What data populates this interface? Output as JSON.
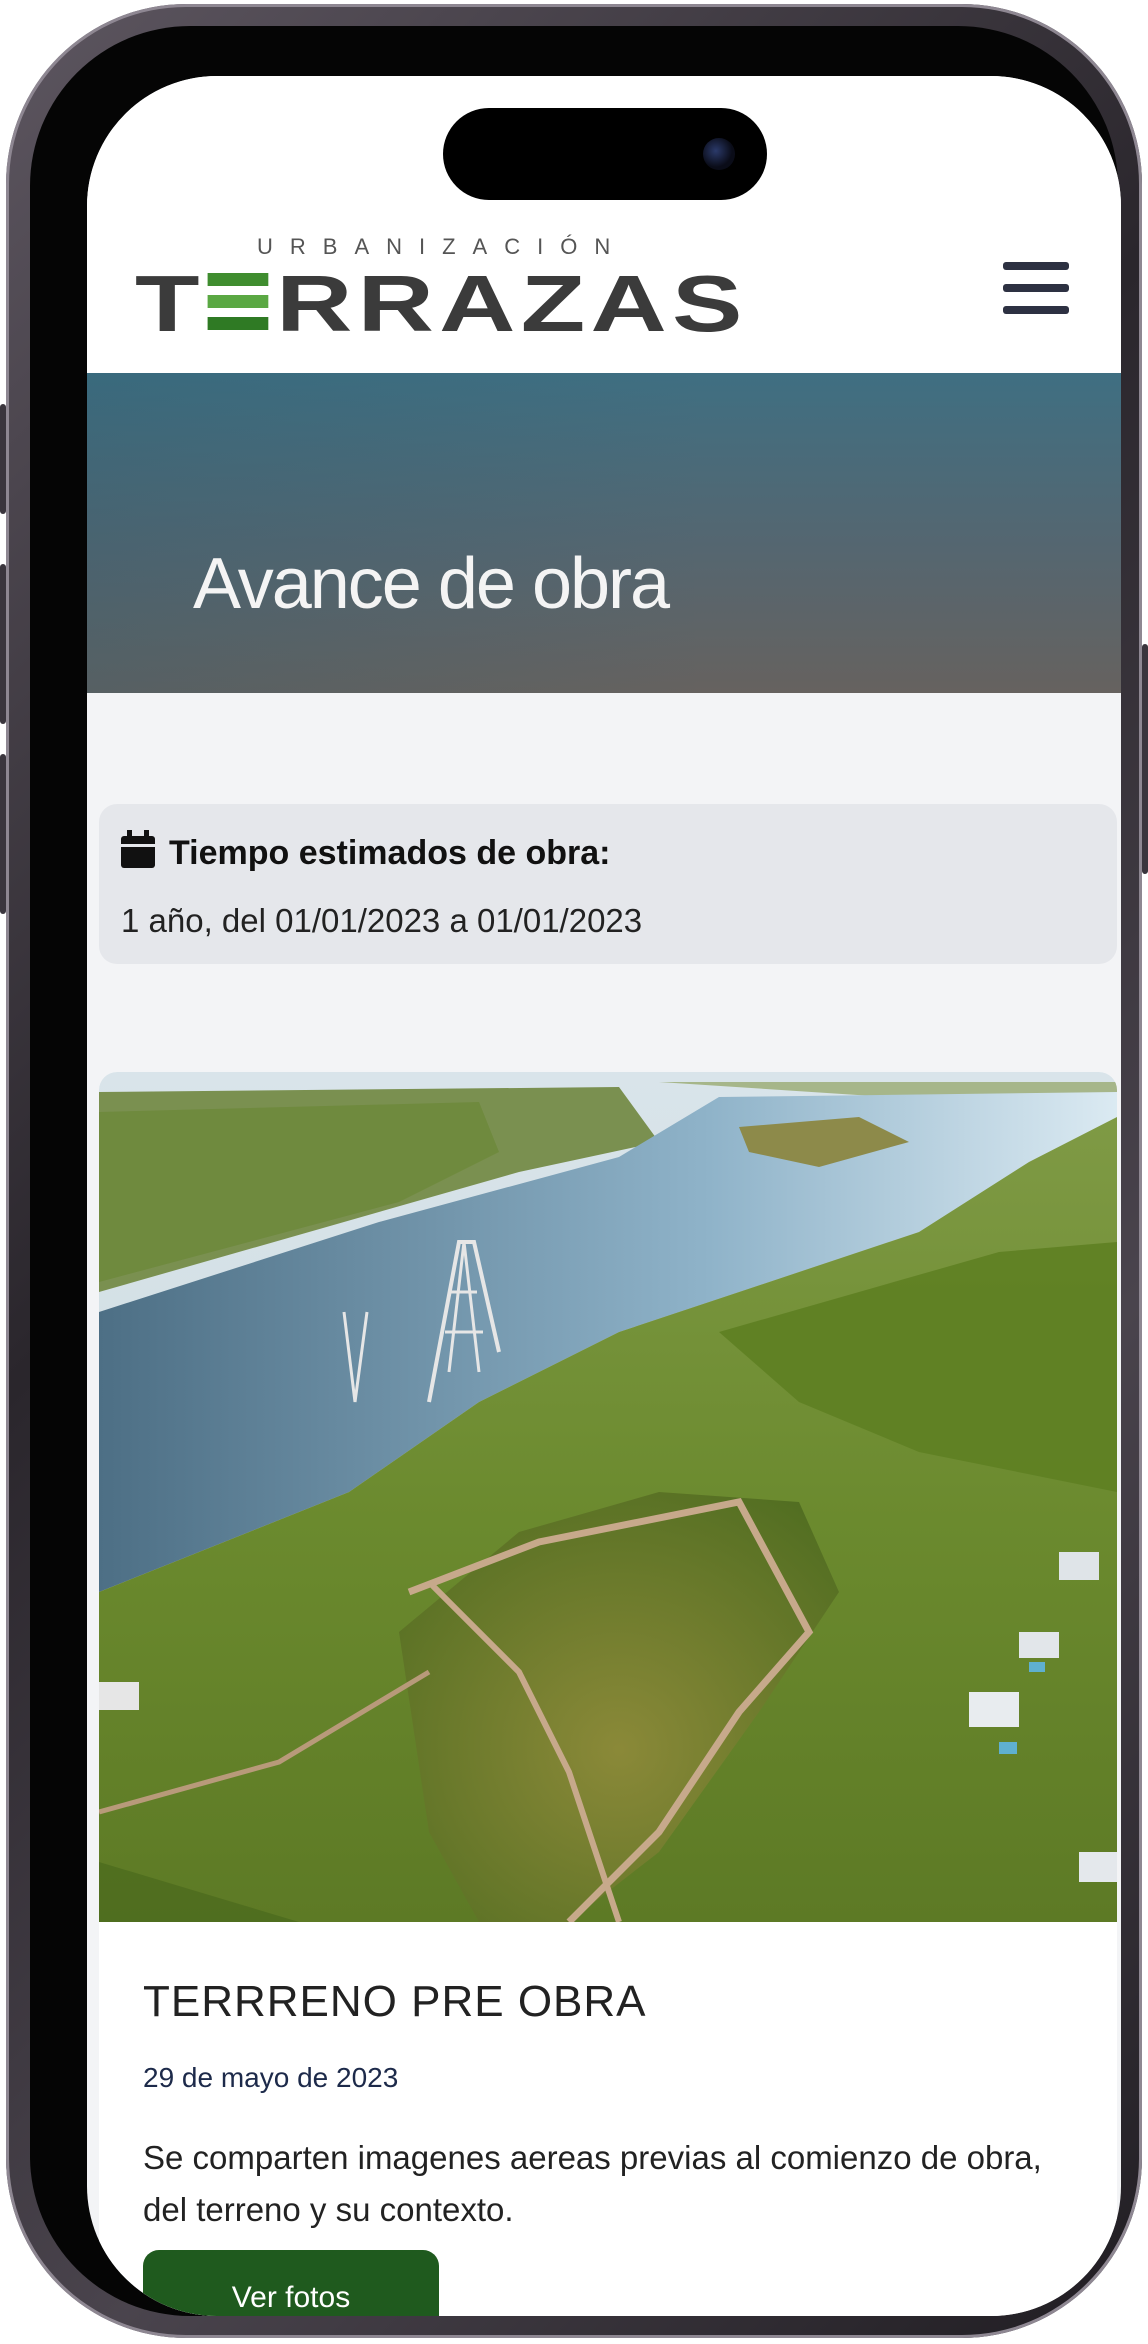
{
  "header": {
    "logo_subtitle": "URBANIZACIÓN",
    "logo_title_start": "T",
    "logo_title_end": "RRAZAS",
    "menu_icon": "hamburger-menu-icon"
  },
  "hero": {
    "title": "Avance de obra"
  },
  "info": {
    "icon": "calendar-icon",
    "label": "Tiempo estimados de obra:",
    "value": "1 año, del 01/01/2023 a 01/01/2023"
  },
  "card": {
    "image": "aerial-river-landscape-photo",
    "title": "TERRRENO PRE OBRA",
    "date": "29 de mayo de 2023",
    "text": "Se comparten imagenes aereas previas al comienzo de obra, del terreno y su contexto.",
    "button_label": "Ver fotos"
  },
  "colors": {
    "accent_green": "#1f5a1e",
    "logo_green": "#3f8d2f",
    "hero": "#556670"
  }
}
